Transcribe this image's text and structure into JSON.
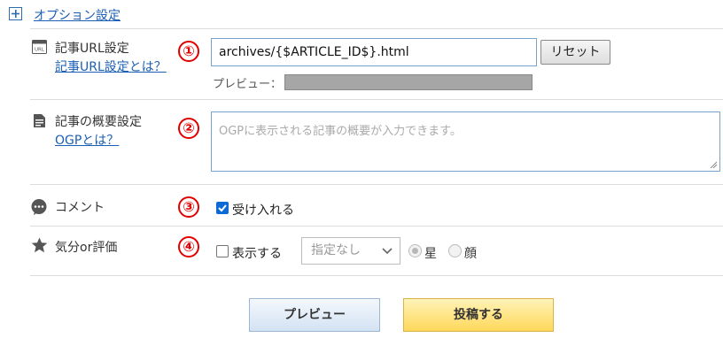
{
  "header": {
    "toggle_icon": "plus-box-icon",
    "options_link": "オプション設定"
  },
  "url_setting": {
    "badge": "①",
    "label": "記事URL設定",
    "help_link": "記事URL設定とは？",
    "icon": "url-icon",
    "value": "archives/{$ARTICLE_ID$}.html",
    "reset_button": "リセット",
    "preview_label": "プレビュー："
  },
  "summary_setting": {
    "badge": "②",
    "label": "記事の概要設定",
    "help_link": "OGPとは？",
    "icon": "document-icon",
    "placeholder": "OGPに表示される記事の概要が入力できます。"
  },
  "comment_setting": {
    "badge": "③",
    "label": "コメント",
    "icon": "speech-bubble-icon",
    "checkbox_label": "受け入れる",
    "checked": true
  },
  "rating_setting": {
    "badge": "④",
    "label": "気分or評価",
    "icon": "star-icon",
    "checkbox_label": "表示する",
    "checked": false,
    "select_value": "指定なし",
    "radio_options": [
      "星",
      "顔"
    ],
    "selected_radio": "星"
  },
  "footer": {
    "preview_button": "プレビュー",
    "post_button": "投稿する"
  },
  "colors": {
    "link": "#1a5fb4",
    "badge": "#e00000",
    "post_button": "#ffd85a",
    "preview_button": "#d3e2f3"
  }
}
